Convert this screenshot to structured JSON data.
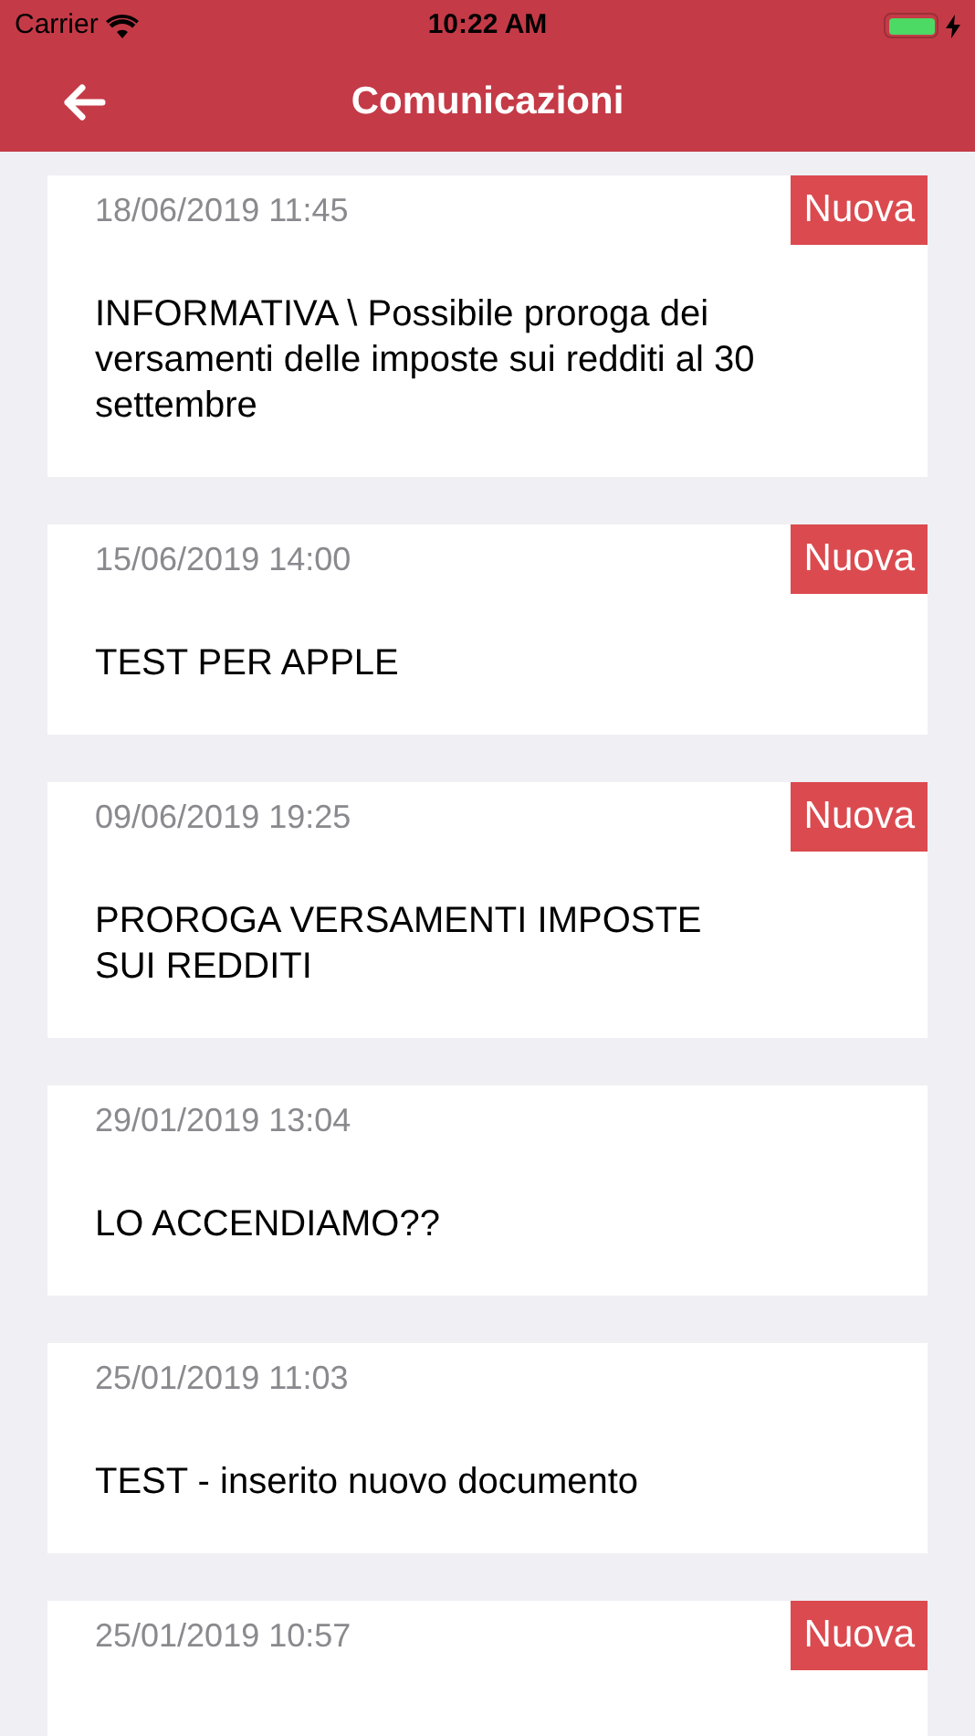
{
  "status_bar": {
    "carrier": "Carrier",
    "time": "10:22 AM",
    "charging": true
  },
  "header": {
    "title": "Comunicazioni"
  },
  "messages": [
    {
      "date": "18/06/2019 11:45",
      "new": true,
      "badge": "Nuova",
      "text": "INFORMATIVA \\ Possibile proroga dei versamenti delle imposte sui redditi al 30 settembre"
    },
    {
      "date": "15/06/2019 14:00",
      "new": true,
      "badge": "Nuova",
      "text": "TEST PER APPLE"
    },
    {
      "date": "09/06/2019 19:25",
      "new": true,
      "badge": "Nuova",
      "text": "PROROGA VERSAMENTI IMPOSTE\nSUI REDDITI"
    },
    {
      "date": "29/01/2019 13:04",
      "new": false,
      "text": "LO ACCENDIAMO??"
    },
    {
      "date": "25/01/2019 11:03",
      "new": false,
      "text": "TEST - inserito nuovo documento"
    },
    {
      "date": "25/01/2019 10:57",
      "new": true,
      "badge": "Nuova"
    }
  ]
}
